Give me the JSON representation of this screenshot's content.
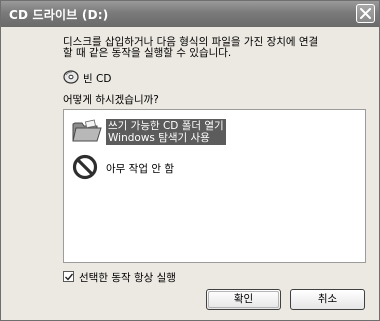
{
  "window": {
    "title": "CD 드라이브 (D:)"
  },
  "dialog": {
    "description_line1": "디스크를 삽입하거나 다음 형식의 파일을 가진 장치에 연결",
    "description_line2": "할 때 같은 동작을 실행할 수 있습니다.",
    "content_type_label": "빈 CD",
    "question": "어떻게 하시겠습니까?",
    "options": [
      {
        "label_line1": "쓰기 가능한 CD 폴더 열기",
        "label_line2": "Windows 탐색기 사용",
        "icon": "folder-icon",
        "selected": true
      },
      {
        "label": "아무 작업 안 함",
        "icon": "no-action-icon",
        "selected": false
      }
    ],
    "always_do_label": "선택한 동작 항상 실행",
    "always_do_checked": true,
    "ok_label": "확인",
    "cancel_label": "취소"
  },
  "colors": {
    "titlebar": "#7a7a7a",
    "selection": "#5c5c5c",
    "background": "#ece9e2"
  }
}
